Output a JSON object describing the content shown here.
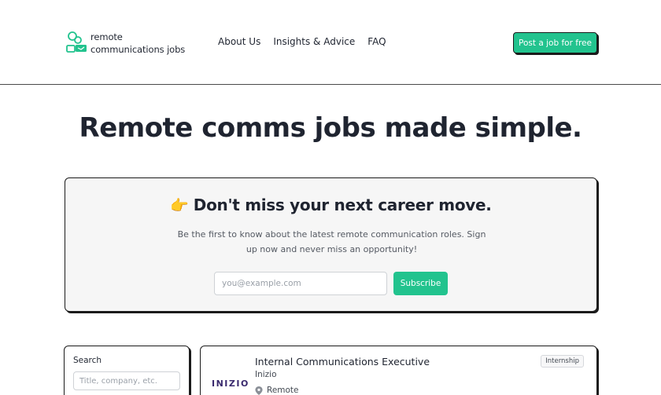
{
  "header": {
    "logo_line1": "remote",
    "logo_line2": "communications jobs",
    "nav": [
      "About Us",
      "Insights & Advice",
      "FAQ"
    ],
    "post_button": "Post a job for free"
  },
  "hero": {
    "title": "Remote comms jobs made simple."
  },
  "newsletter": {
    "emoji": "👉",
    "title": "Don't miss your next career move.",
    "text": "Be the first to know about the latest remote communication roles. Sign up now and never miss an opportunity!",
    "email_placeholder": "you@example.com",
    "subscribe_label": "Subscribe"
  },
  "search": {
    "label": "Search",
    "placeholder": "Title, company, etc."
  },
  "jobs": [
    {
      "title": "Internal Communications Executive",
      "company": "Inizio",
      "company_logo_text": "INIZIO",
      "location": "Remote",
      "tag": "Internship"
    }
  ],
  "colors": {
    "accent": "#22c38e",
    "text": "#1f2430",
    "border": "#1b1b1b"
  }
}
